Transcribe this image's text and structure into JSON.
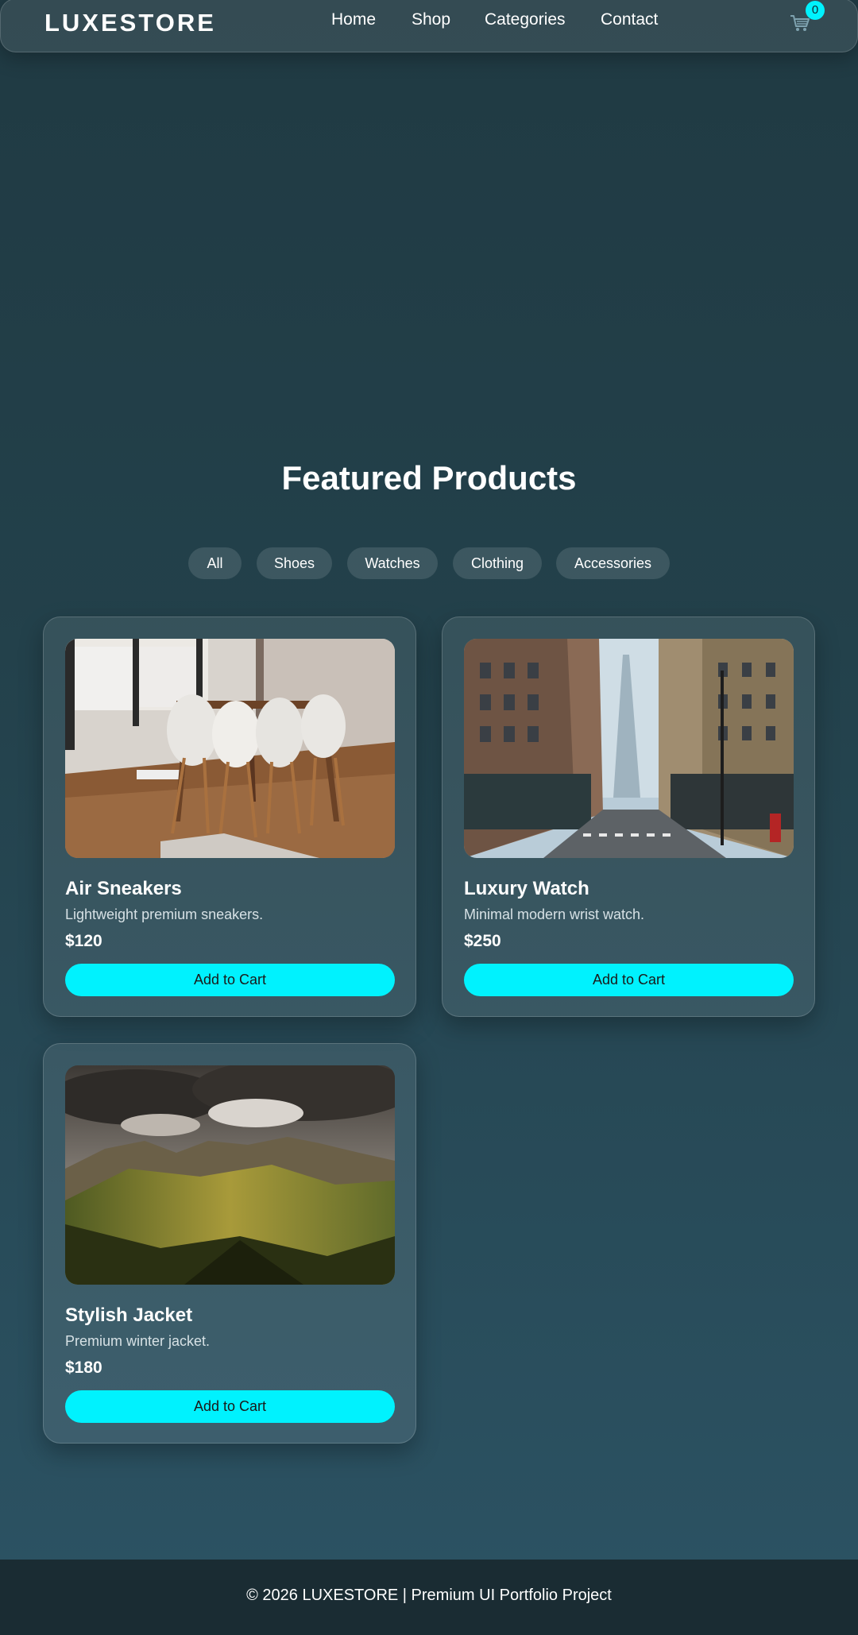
{
  "header": {
    "logo": "LUXESTORE",
    "nav": [
      "Home",
      "Shop",
      "Categories",
      "Contact"
    ],
    "cart_count": "0",
    "cart_icon": "cart-icon"
  },
  "main": {
    "section_title": "Featured Products",
    "filters": [
      "All",
      "Shoes",
      "Watches",
      "Clothing",
      "Accessories"
    ],
    "products": [
      {
        "name": "Air Sneakers",
        "description": "Lightweight premium sneakers.",
        "price": "$120",
        "button": "Add to Cart",
        "image": "dining-room-photo"
      },
      {
        "name": "Luxury Watch",
        "description": "Minimal modern wrist watch.",
        "price": "$250",
        "button": "Add to Cart",
        "image": "city-street-photo"
      },
      {
        "name": "Stylish Jacket",
        "description": "Premium winter jacket.",
        "price": "$180",
        "button": "Add to Cart",
        "image": "mountain-landscape-photo"
      }
    ]
  },
  "footer": {
    "text": "© 2026 LUXESTORE | Premium UI Portfolio Project"
  },
  "colors": {
    "accent": "#00f2fe",
    "background_top": "#203a43",
    "background_bottom": "#2c5364",
    "footer": "#1a2c33"
  }
}
